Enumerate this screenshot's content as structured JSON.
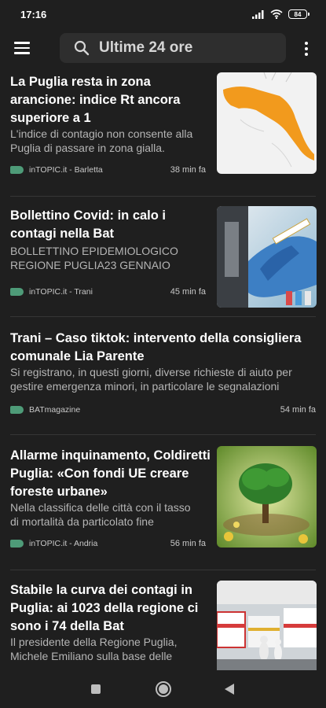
{
  "status_bar": {
    "time": "17:16",
    "battery": "84"
  },
  "search": {
    "text": "Ultime 24 ore"
  },
  "articles": [
    {
      "headline": "La Puglia resta in zona arancione: indice Rt ancora superiore a 1",
      "snippet": "L'indice di contagio non consente alla Puglia di passare in zona gialla.",
      "source": "inTOPIC.it - Barletta",
      "time": "38 min fa",
      "image_desc": "map-thumbnail"
    },
    {
      "headline": "Bollettino Covid: in calo i contagi nella Bat",
      "snippet": "BOLLETTINO EPIDEMIOLOGICO REGIONE PUGLIA23 GENNAIO",
      "source": "inTOPIC.it - Trani",
      "time": "45 min fa",
      "image_desc": "lab-thumbnail"
    },
    {
      "headline": "Trani – Caso tiktok: intervento della consigliera comunale Lia Parente",
      "snippet": "Si registrano, in questi giorni, diverse richieste di aiuto per gestire emergenza minori, in particolare le segnalazioni",
      "source": "BATmagazine",
      "time": "54 min fa"
    },
    {
      "headline": "Allarme inquinamento, Coldiretti Puglia: «Con fondi UE creare foreste urbane»",
      "snippet": "Nella classifica delle città con il tasso di mortalità da particolato fine",
      "source": "inTOPIC.it - Andria",
      "time": "56 min fa",
      "image_desc": "tree-thumbnail"
    },
    {
      "headline": "Stabile la curva dei contagi in Puglia: ai 1023 della regione ci sono i 74 della Bat",
      "snippet": "Il presidente della Regione Puglia, Michele Emiliano sulla base delle",
      "image_desc": "ambulance-thumbnail"
    }
  ],
  "colors": {
    "background": "#1f1f1f",
    "tag": "#4e9b78",
    "divider": "#363636"
  }
}
